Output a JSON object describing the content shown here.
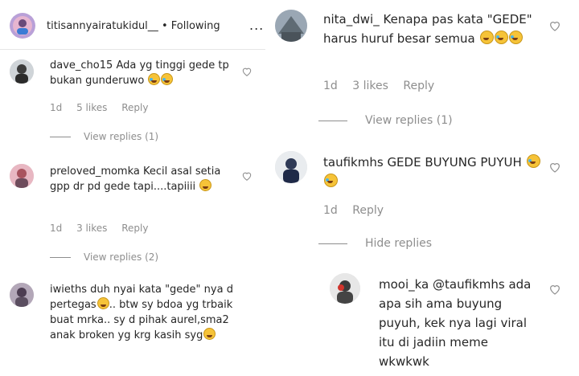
{
  "left": {
    "header": {
      "username": "titisannyairatukidul__",
      "separator": " • ",
      "follow_status": "Following",
      "more": "..."
    },
    "comments": [
      {
        "username": "dave_cho15",
        "text": "Ada yg tinggi gede tp bukan gunderuwo",
        "emojis": [
          "rofl",
          "rofl"
        ],
        "time": "1d",
        "likes": "5 likes",
        "reply": "Reply",
        "view_replies": "View replies (1)"
      },
      {
        "username": "preloved_momka",
        "text": "Kecil asal setia gpp dr pd gede tapi....tapiiii",
        "emojis": [
          "grin"
        ],
        "time": "1d",
        "likes": "3 likes",
        "reply": "Reply",
        "view_replies": "View replies (2)"
      },
      {
        "username": "iwieths",
        "text_part1": "duh nyai kata \"gede\" nya d pertegas",
        "text_part2": ".. btw sy bdoa yg trbaik buat mrka.. sy d pihak aurel,sma2 anak broken yg krg kasih syg",
        "emojis": [
          "grin",
          "grin"
        ]
      }
    ]
  },
  "right": {
    "comments": [
      {
        "username": "nita_dwi_",
        "text": "Kenapa pas kata \"GEDE\" harus huruf besar semua",
        "emojis": [
          "smile",
          "rofl",
          "rofl"
        ],
        "time": "1d",
        "likes": "3 likes",
        "reply": "Reply",
        "view_replies": "View replies (1)"
      },
      {
        "username": "taufikmhs",
        "text": "GEDE BUYUNG PUYUH",
        "emojis": [
          "joy",
          "joy"
        ],
        "time": "1d",
        "reply": "Reply",
        "hide_replies": "Hide replies"
      },
      {
        "username": "mooi_ka",
        "mention": "@taufikmhs",
        "text": "ada apa sih ama buyung puyuh, kek nya lagi viral itu di jadiin meme wkwkwk"
      }
    ]
  },
  "colors": {
    "text": "#262626",
    "secondary": "#8e8e8e",
    "border": "#e6e6e6"
  },
  "icons": [
    "heart-icon",
    "more-icon",
    "avatar"
  ]
}
